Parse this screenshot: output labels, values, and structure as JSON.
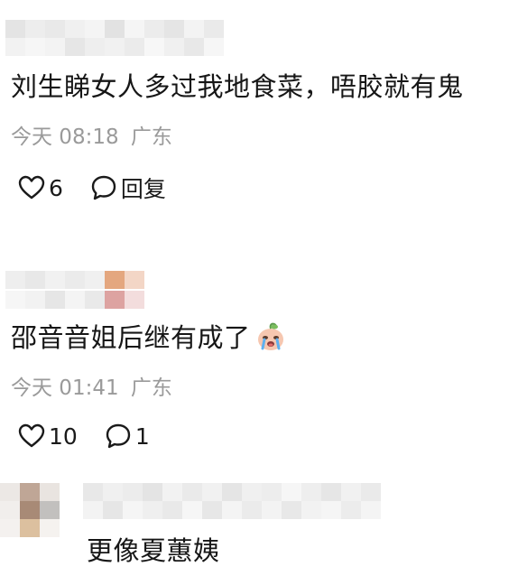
{
  "comments": [
    {
      "text": "刘生睇女人多过我地食菜，唔胶就有鬼",
      "time": "今天 08:18",
      "location": "广东",
      "likes": "6",
      "reply_label": "回复"
    },
    {
      "text": "邵音音姐后继有成了",
      "emoji": "crying-face-emoji",
      "time": "今天 01:41",
      "location": "广东",
      "likes": "10",
      "replies": "1"
    },
    {
      "text": "更像夏蕙姨"
    }
  ],
  "icons": {
    "like": "heart-outline-icon",
    "reply": "speech-bubble-outline-icon"
  }
}
